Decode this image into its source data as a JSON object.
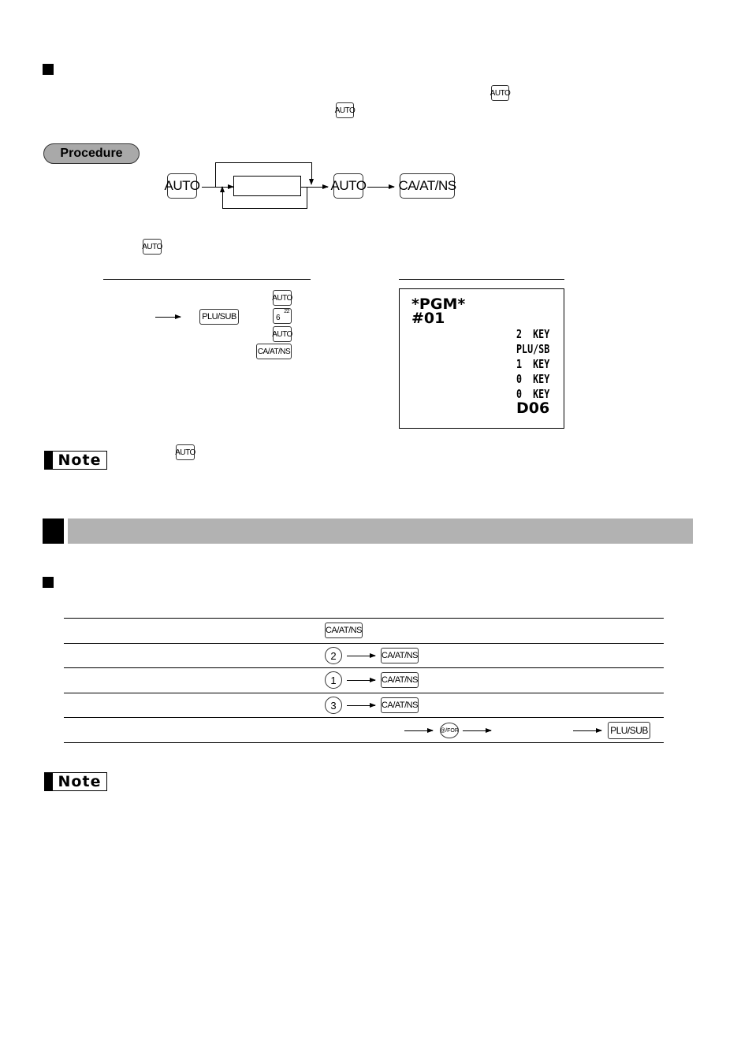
{
  "section1": {
    "bullet": "square",
    "inline_keys": [
      "AUTO",
      "AUTO"
    ]
  },
  "procedure": {
    "label": "Procedure",
    "flow": {
      "start_key": "AUTO",
      "loop_box": "",
      "end_key": "AUTO",
      "final_key": "CA/AT/NS"
    }
  },
  "example": {
    "inline_key": "AUTO",
    "key_operation": {
      "plu_key": "PLU/SUB",
      "keys": [
        "AUTO",
        "6",
        "AUTO",
        "CA/AT/NS"
      ],
      "key6_superscript": "22"
    },
    "print": {
      "header1": "*PGM*",
      "header2": "#01",
      "lines": [
        "2  KEY",
        "PLU/SB",
        "1  KEY",
        "0  KEY",
        "0  KEY"
      ],
      "code": "D06"
    }
  },
  "note1": {
    "label": "Note",
    "inline_key": "AUTO"
  },
  "section2": {
    "title": "",
    "subsection_bullet": "square",
    "table": {
      "rows": [
        {
          "keys": [
            "CA/AT/NS"
          ]
        },
        {
          "digit": "2",
          "keys": [
            "CA/AT/NS"
          ]
        },
        {
          "digit": "1",
          "keys": [
            "CA/AT/NS"
          ]
        },
        {
          "digit": "3",
          "keys": [
            "CA/AT/NS"
          ]
        },
        {
          "for_key": "@/FOR",
          "end_key": "PLU/SUB"
        }
      ]
    }
  },
  "note2": {
    "label": "Note"
  }
}
